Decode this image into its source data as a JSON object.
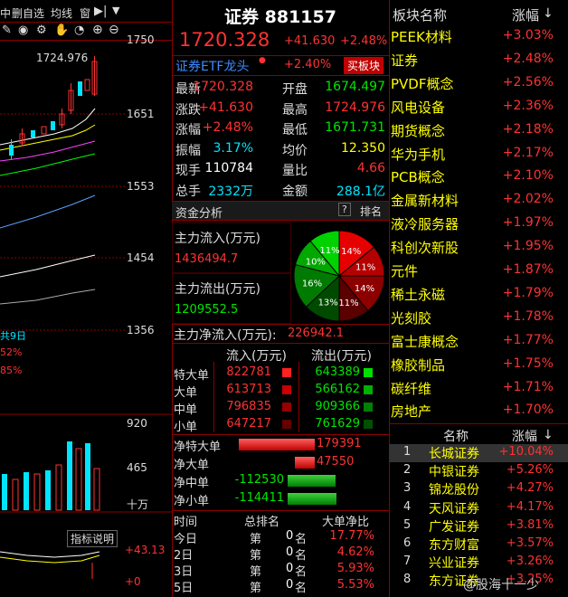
{
  "left": {
    "toolbar": [
      "中",
      "删自选",
      "均线",
      "窗"
    ],
    "axis_labels": [
      "1750",
      "1651",
      "1553",
      "1454",
      "1356"
    ],
    "peak_label": "1724.976",
    "overlay_lines": [
      "共9日",
      "52%",
      "85%"
    ],
    "volume_labels": [
      "920",
      "465",
      "十万"
    ],
    "indicator_button": "指标说明",
    "indicator_values": [
      "+43.13",
      "+0"
    ]
  },
  "header": {
    "title": "证券 881157",
    "price": "1720.328",
    "change": "+41.630",
    "change_pct": "+2.48%"
  },
  "leader": {
    "label": "证券ETF龙头",
    "pct": "+2.40%",
    "button": "买板块"
  },
  "quote_rows": [
    {
      "k1": "最新",
      "v1": "1720.328",
      "c1": "red",
      "k2": "开盘",
      "v2": "1674.497",
      "c2": "green"
    },
    {
      "k1": "涨跌",
      "v1": "+41.630",
      "c1": "red",
      "k2": "最高",
      "v2": "1724.976",
      "c2": "red"
    },
    {
      "k1": "涨幅",
      "v1": "+2.48%",
      "c1": "red",
      "k2": "最低",
      "v2": "1671.731",
      "c2": "green"
    },
    {
      "k1": "振幅",
      "v1": "3.17%",
      "c1": "cyan",
      "k2": "均价",
      "v2": "12.350",
      "c2": "yellow"
    },
    {
      "k1": "现手",
      "v1": "110784",
      "c1": "white",
      "k2": "量比",
      "v2": "4.66",
      "c2": "red"
    },
    {
      "k1": "总手",
      "v1": "2332万",
      "c1": "cyan",
      "k2": "金额",
      "v2": "288.1亿",
      "c2": "cyan"
    }
  ],
  "fund": {
    "title": "资金分析",
    "help": "?",
    "rank_btn": "排名",
    "inflow_label": "主力流入(万元)",
    "inflow_value": "1436494.7",
    "outflow_label": "主力流出(万元)",
    "outflow_value": "1209552.5",
    "net_label": "主力净流入(万元):",
    "net_value": "226942.1"
  },
  "pie": [
    {
      "pct": 14,
      "label": "14%",
      "color": "#e60000"
    },
    {
      "pct": 11,
      "label": "11%",
      "color": "#b40000"
    },
    {
      "pct": 14,
      "label": "14%",
      "color": "#8c0000"
    },
    {
      "pct": 11,
      "label": "11%",
      "color": "#5a0000"
    },
    {
      "pct": 13,
      "label": "13%",
      "color": "#004a00"
    },
    {
      "pct": 16,
      "label": "16%",
      "color": "#007a00"
    },
    {
      "pct": 10,
      "label": "10%",
      "color": "#00a800"
    },
    {
      "pct": 11,
      "label": "11%",
      "color": "#00d200"
    }
  ],
  "flow_header": {
    "in": "流入(万元)",
    "out": "流出(万元)"
  },
  "flow_rows": [
    {
      "label": "特大单",
      "in": "822781",
      "in_color": "#ff2020",
      "out": "643389",
      "out_color": "#00e000"
    },
    {
      "label": "大单",
      "in": "613713",
      "in_color": "#c80000",
      "out": "566162",
      "out_color": "#00b000"
    },
    {
      "label": "中单",
      "in": "796835",
      "in_color": "#960000",
      "out": "909366",
      "out_color": "#008000"
    },
    {
      "label": "小单",
      "in": "647217",
      "in_color": "#640000",
      "out": "761629",
      "out_color": "#005000"
    }
  ],
  "net_rows": [
    {
      "label": "净特大单",
      "value": "179391",
      "amount": 179391
    },
    {
      "label": "净大单",
      "value": "47550",
      "amount": 47550
    },
    {
      "label": "净中单",
      "value": "-112530",
      "amount": -112530
    },
    {
      "label": "净小单",
      "value": "-114411",
      "amount": -114411
    }
  ],
  "rank_header": {
    "time": "时间",
    "rank": "总排名",
    "ratio": "大单净比"
  },
  "rank_rows": [
    {
      "period": "今日",
      "di": "第",
      "num": "0",
      "ming": "名",
      "ratio": "17.77%"
    },
    {
      "period": "2日",
      "di": "第",
      "num": "0",
      "ming": "名",
      "ratio": "4.62%"
    },
    {
      "period": "3日",
      "di": "第",
      "num": "0",
      "ming": "名",
      "ratio": "5.93%"
    },
    {
      "period": "5日",
      "di": "第",
      "num": "0",
      "ming": "名",
      "ratio": "5.53%"
    }
  ],
  "sectors_header": {
    "name": "板块名称",
    "pct": "涨幅"
  },
  "sectors": [
    {
      "name": "PEEK材料",
      "pct": "+3.03%"
    },
    {
      "name": "证券",
      "pct": "+2.48%"
    },
    {
      "name": "PVDF概念",
      "pct": "+2.56%"
    },
    {
      "name": "风电设备",
      "pct": "+2.36%"
    },
    {
      "name": "期货概念",
      "pct": "+2.18%"
    },
    {
      "name": "华为手机",
      "pct": "+2.17%"
    },
    {
      "name": "PCB概念",
      "pct": "+2.10%"
    },
    {
      "name": "金属新材料",
      "pct": "+2.02%"
    },
    {
      "name": "液冷服务器",
      "pct": "+1.97%"
    },
    {
      "name": "科创次新股",
      "pct": "+1.95%"
    },
    {
      "name": "元件",
      "pct": "+1.87%"
    },
    {
      "name": "稀土永磁",
      "pct": "+1.79%"
    },
    {
      "name": "光刻胶",
      "pct": "+1.78%"
    },
    {
      "name": "富士康概念",
      "pct": "+1.77%"
    },
    {
      "name": "橡胶制品",
      "pct": "+1.75%"
    },
    {
      "name": "碳纤维",
      "pct": "+1.71%"
    },
    {
      "name": "房地产",
      "pct": "+1.70%"
    }
  ],
  "stocks_header": {
    "name": "名称",
    "pct": "涨幅"
  },
  "stocks": [
    {
      "no": "1",
      "name": "长城证券",
      "pct": "+10.04%"
    },
    {
      "no": "2",
      "name": "中银证券",
      "pct": "+5.26%"
    },
    {
      "no": "3",
      "name": "锦龙股份",
      "pct": "+4.27%"
    },
    {
      "no": "4",
      "name": "天风证券",
      "pct": "+4.17%"
    },
    {
      "no": "5",
      "name": "广发证券",
      "pct": "+3.81%"
    },
    {
      "no": "6",
      "name": "东方财富",
      "pct": "+3.57%"
    },
    {
      "no": "7",
      "name": "兴业证券",
      "pct": "+3.26%"
    },
    {
      "no": "8",
      "name": "东方证券",
      "pct": "+3.25%"
    }
  ],
  "watermark": "@股海十一少",
  "colors": {
    "up": "#ff3232",
    "down": "#00e600",
    "grid": "#8b0000",
    "accent": "#ffff00"
  }
}
